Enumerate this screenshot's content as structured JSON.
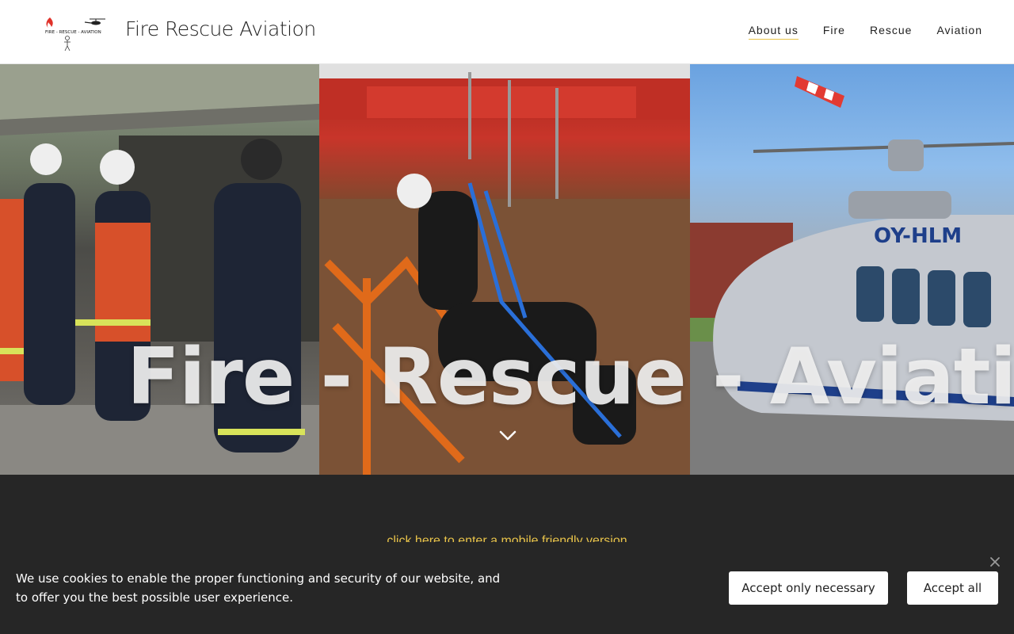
{
  "header": {
    "logo_text": "FIRE - RESCUE - AVIATION",
    "title": "Fire Rescue Aviation",
    "nav": [
      {
        "label": "About us",
        "active": true
      },
      {
        "label": "Fire",
        "active": false
      },
      {
        "label": "Rescue",
        "active": false
      },
      {
        "label": "Aviation",
        "active": false
      }
    ]
  },
  "hero": {
    "text": "Fire - Rescue - Aviation",
    "scroll_icon": "chevron-down-icon"
  },
  "content": {
    "mobile_link": "click here to enter a mobile friendly version"
  },
  "cookie": {
    "message": "We use cookies to enable the proper functioning and security of our website, and to offer you the best possible user experience.",
    "accept_necessary": "Accept only necessary",
    "accept_all": "Accept all",
    "close_icon": "close-icon"
  },
  "colors": {
    "accent": "#e8c34a",
    "dark_bg": "#262626"
  }
}
